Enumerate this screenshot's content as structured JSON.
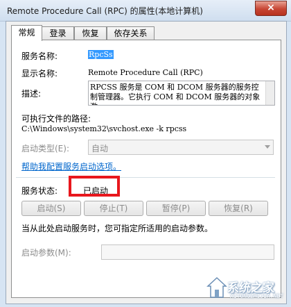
{
  "window": {
    "title": "Remote Procedure Call (RPC) 的属性(本地计算机)",
    "close_label": "×"
  },
  "tabs": [
    {
      "label": "常规",
      "active": true
    },
    {
      "label": "登录",
      "active": false
    },
    {
      "label": "恢复",
      "active": false
    },
    {
      "label": "依存关系",
      "active": false
    }
  ],
  "general": {
    "service_name_label": "服务名称:",
    "service_name_value": "RpcSs",
    "display_name_label": "显示名称:",
    "display_name_value": "Remote Procedure Call (RPC)",
    "description_label": "描述:",
    "description_value": "RPCSS 服务是 COM 和 DCOM 服务器的服务控制管理器。它执行 COM 和 DCOM 服务器的对象激",
    "exe_path_label": "可执行文件的路径:",
    "exe_path_value": "C:\\Windows\\system32\\svchost.exe -k rpcss",
    "startup_type_label": "启动类型(E):",
    "startup_type_value": "自动",
    "help_link": "帮助我配置服务启动选项。",
    "status_label": "服务状态:",
    "status_value": "已启动",
    "start_button": "启动(S)",
    "stop_button": "停止(T)",
    "pause_button": "暂停(P)",
    "resume_button": "恢复(R)",
    "hint": "当从此处启动服务时，您可指定所适用的启动参数。",
    "start_params_label": "启动参数(M):",
    "start_params_value": ""
  },
  "watermark": {
    "text": "系统之家",
    "sub": "XITONGZHIJIA.NET"
  }
}
